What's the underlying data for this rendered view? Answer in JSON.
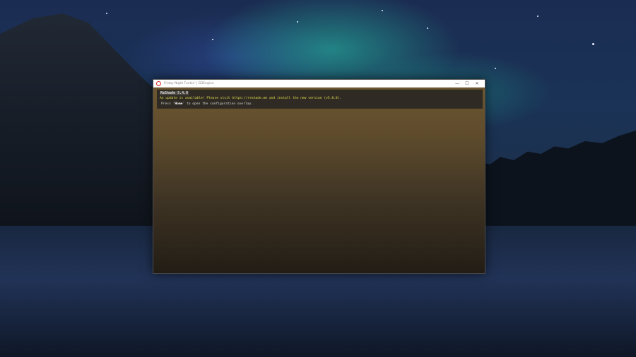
{
  "window": {
    "title": "Friday Night Funkin' | D3Engine",
    "app_icon": "opera-icon",
    "controls": {
      "minimize": "—",
      "maximize": "☐",
      "close": "✕"
    }
  },
  "overlay": {
    "version": "ReShade 5.4.0",
    "update_message": "An update is available! Please visit https://reshade.me and install the new version (v5.8.0).",
    "hint_prefix": "Press '",
    "hint_key": "Home",
    "hint_suffix": "' to open the configuration overlay."
  },
  "colors": {
    "update_text": "#e6e04a",
    "client_top": "#6b5630",
    "client_bottom": "#221d15",
    "icon_ring": "#d42a2a"
  }
}
